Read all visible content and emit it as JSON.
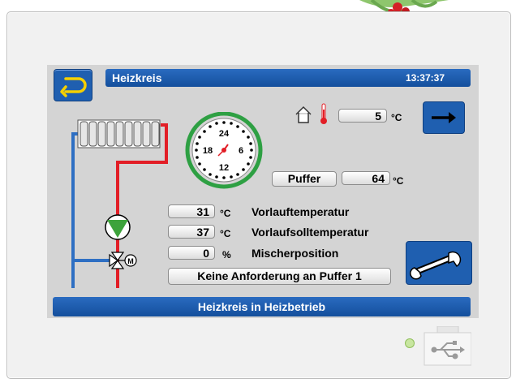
{
  "header": {
    "title": "Heizkreis",
    "time": "13:37:37"
  },
  "outdoor": {
    "value": "5",
    "unit": "°C"
  },
  "clock": {
    "labels": [
      "24",
      "6",
      "12",
      "18"
    ]
  },
  "buffer": {
    "label": "Puffer",
    "value": "64",
    "unit": "°C"
  },
  "readings": [
    {
      "value": "31",
      "unit": "°C",
      "label": "Vorlauftemperatur"
    },
    {
      "value": "37",
      "unit": "°C",
      "label": "Vorlaufsolltemperatur"
    },
    {
      "value": "0",
      "unit": "%",
      "label": "Mischerposition"
    }
  ],
  "request_text": "Keine Anforderung an Puffer 1",
  "status_text": "Heizkreis in Heizbetrieb",
  "icons": {
    "back": "return-arrow-icon",
    "forward": "right-arrow-icon",
    "settings": "wrench-icon",
    "house": "house-icon",
    "thermometer": "thermometer-icon",
    "usb": "usb-icon"
  },
  "colors": {
    "accent": "#1f5fb0",
    "pipe_hot": "#e21e26",
    "pipe_cold": "#2e6fc3",
    "pump": "#3da33b",
    "led": "#c8e6a0"
  }
}
